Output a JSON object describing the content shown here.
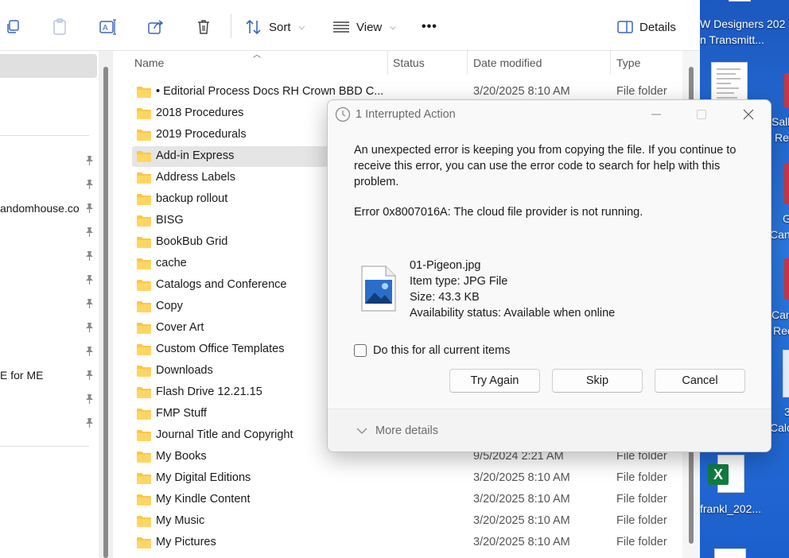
{
  "toolbar": {
    "sort_label": "Sort",
    "view_label": "View",
    "more_label": "•••",
    "details_label": "Details"
  },
  "nav": {
    "texts": [
      "andomhouse.co",
      "E for ME"
    ]
  },
  "columns": {
    "name": "Name",
    "status": "Status",
    "date": "Date modified",
    "type": "Type"
  },
  "files": [
    {
      "name": "• Editorial Process Docs RH Crown BBD C...",
      "date": "3/20/2025 8:10 AM",
      "type": "File folder"
    },
    {
      "name": "2018 Procedures",
      "date": "",
      "type": ""
    },
    {
      "name": "2019 Procedurals",
      "date": "",
      "type": ""
    },
    {
      "name": "Add-in Express",
      "date": "",
      "type": ""
    },
    {
      "name": "Address  Labels",
      "date": "",
      "type": ""
    },
    {
      "name": "backup rollout",
      "date": "",
      "type": ""
    },
    {
      "name": "BISG",
      "date": "",
      "type": ""
    },
    {
      "name": "BookBub Grid",
      "date": "",
      "type": ""
    },
    {
      "name": "cache",
      "date": "",
      "type": ""
    },
    {
      "name": "Catalogs and Conference",
      "date": "",
      "type": ""
    },
    {
      "name": "Copy",
      "date": "",
      "type": ""
    },
    {
      "name": "Cover Art",
      "date": "",
      "type": ""
    },
    {
      "name": "Custom Office Templates",
      "date": "",
      "type": ""
    },
    {
      "name": "Downloads",
      "date": "",
      "type": ""
    },
    {
      "name": "Flash Drive 12.21.15",
      "date": "",
      "type": ""
    },
    {
      "name": "FMP Stuff",
      "date": "",
      "type": ""
    },
    {
      "name": "Journal Title and Copyright",
      "date": "",
      "type": ""
    },
    {
      "name": "My Books",
      "date": "9/5/2024 2:21 AM",
      "type": "File folder"
    },
    {
      "name": "My Digital Editions",
      "date": "3/20/2025 8:10 AM",
      "type": "File folder"
    },
    {
      "name": "My Kindle Content",
      "date": "3/20/2025 8:10 AM",
      "type": "File folder"
    },
    {
      "name": "My Music",
      "date": "3/20/2025 8:10 AM",
      "type": "File folder"
    },
    {
      "name": "My Pictures",
      "date": "3/20/2025 8:10 AM",
      "type": "File folder"
    }
  ],
  "desktop": {
    "texts": [
      "W Designers 202",
      "n Transmitt...",
      "Sall",
      "Re",
      "G",
      "Can",
      "Can",
      "Rec",
      "3",
      "Calc",
      "frankl_202..."
    ]
  },
  "dialog": {
    "title": "1 Interrupted Action",
    "message": "An unexpected error is keeping you from copying the file. If you continue to receive this error, you can use the error code to search for help with this problem.",
    "error": "Error 0x8007016A: The cloud file provider is not running.",
    "file": {
      "name": "01-Pigeon.jpg",
      "item_type": "Item type: JPG File",
      "size": "Size: 43.3 KB",
      "availability": "Availability status: Available when online"
    },
    "checkbox_label": "Do this for all current items",
    "buttons": {
      "try_again": "Try Again",
      "skip": "Skip",
      "cancel": "Cancel"
    },
    "more_details": "More details"
  },
  "colors": {
    "folder": "#f8c84a",
    "desktop": "#1e63c8",
    "excel": "#107c41"
  }
}
